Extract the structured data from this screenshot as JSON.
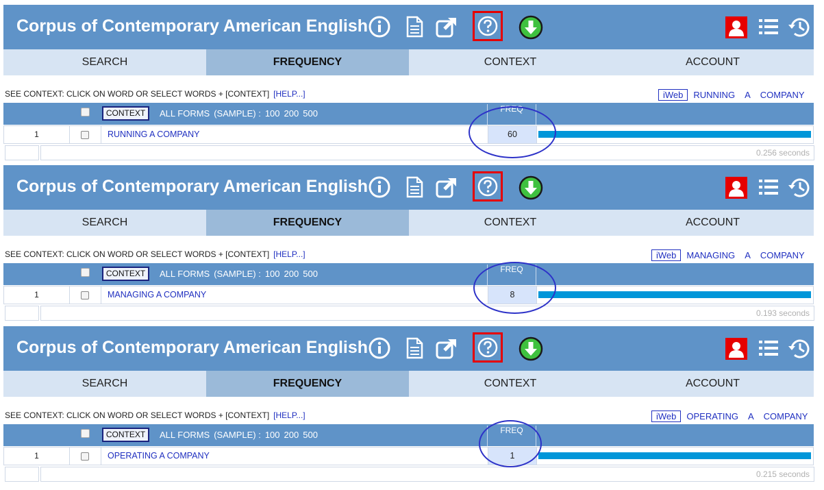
{
  "colors": {
    "header": "#5f93c8",
    "tab_active": "#9bbad9",
    "tab_inactive": "#d7e4f3",
    "link": "#1f2fc0",
    "bar": "#0096d9",
    "highlight": "#e60000",
    "annotation": "#2d32c8"
  },
  "icons": [
    "info-icon",
    "document-icon",
    "share-icon",
    "help-icon",
    "download-icon",
    "user-icon",
    "list-icon",
    "history-icon"
  ],
  "panels": [
    {
      "title": "Corpus of Contemporary American English",
      "tabs": [
        "SEARCH",
        "FREQUENCY",
        "CONTEXT",
        "ACCOUNT"
      ],
      "info": "SEE CONTEXT: CLICK ON WORD OR SELECT WORDS + [CONTEXT]",
      "help_link": "[HELP...]",
      "iweb": {
        "label": "iWeb",
        "words": [
          "RUNNING",
          "A",
          "COMPANY"
        ]
      },
      "context_button": "CONTEXT",
      "all_forms": "ALL FORMS",
      "sample": "(SAMPLE) :",
      "sample_sizes": [
        "100",
        "200",
        "500"
      ],
      "freq_label": "FREQ",
      "row": {
        "num": "1",
        "word": "RUNNING A COMPANY",
        "freq": "60",
        "bar_fraction": 1.0
      },
      "seconds": "0.256 seconds"
    },
    {
      "title": "Corpus of Contemporary American English",
      "tabs": [
        "SEARCH",
        "FREQUENCY",
        "CONTEXT",
        "ACCOUNT"
      ],
      "info": "SEE CONTEXT: CLICK ON WORD OR SELECT WORDS + [CONTEXT]",
      "help_link": "[HELP...]",
      "iweb": {
        "label": "iWeb",
        "words": [
          "MANAGING",
          "A",
          "COMPANY"
        ]
      },
      "context_button": "CONTEXT",
      "all_forms": "ALL FORMS",
      "sample": "(SAMPLE) :",
      "sample_sizes": [
        "100",
        "200",
        "500"
      ],
      "freq_label": "FREQ",
      "row": {
        "num": "1",
        "word": "MANAGING A COMPANY",
        "freq": "8",
        "bar_fraction": 1.0
      },
      "seconds": "0.193 seconds"
    },
    {
      "title": "Corpus of Contemporary American English",
      "tabs": [
        "SEARCH",
        "FREQUENCY",
        "CONTEXT",
        "ACCOUNT"
      ],
      "info": "SEE CONTEXT: CLICK ON WORD OR SELECT WORDS + [CONTEXT]",
      "help_link": "[HELP...]",
      "iweb": {
        "label": "iWeb",
        "words": [
          "OPERATING",
          "A",
          "COMPANY"
        ]
      },
      "context_button": "CONTEXT",
      "all_forms": "ALL FORMS",
      "sample": "(SAMPLE) :",
      "sample_sizes": [
        "100",
        "200",
        "500"
      ],
      "freq_label": "FREQ",
      "row": {
        "num": "1",
        "word": "OPERATING A COMPANY",
        "freq": "1",
        "bar_fraction": 1.0
      },
      "seconds": "0.215 seconds"
    }
  ]
}
